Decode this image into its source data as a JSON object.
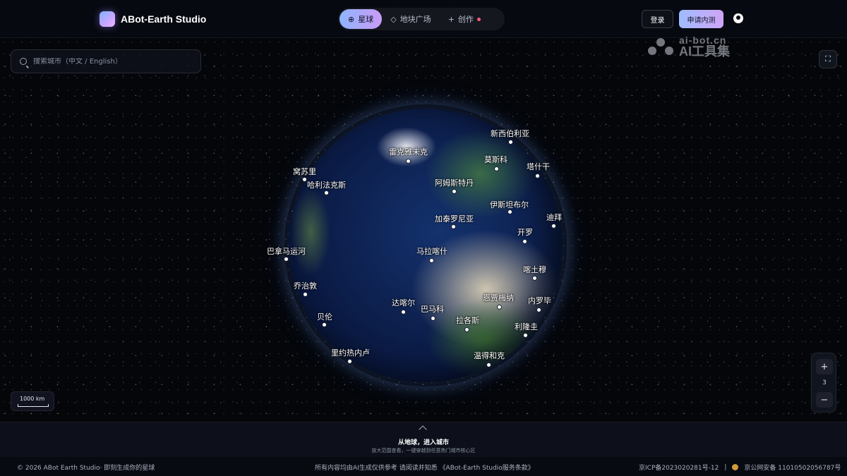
{
  "header": {
    "brand_name": "ABot-Earth Studio",
    "tabs": [
      {
        "label": "星球",
        "icon": "globe-icon",
        "active": true
      },
      {
        "label": "地块广场",
        "icon": "layers-icon",
        "active": false
      },
      {
        "label": "创作",
        "icon": "plus-icon",
        "active": false,
        "badge": true
      }
    ],
    "login_label": "登录",
    "apply_label": "申请内测",
    "github_icon": "github-icon"
  },
  "watermark": {
    "url": "ai-bot.cn",
    "name": "AI工具集"
  },
  "search": {
    "placeholder": "搜索城市（中文 / English）"
  },
  "cities": [
    {
      "name": "新西伯利亚"
    },
    {
      "name": "雷克雅未克"
    },
    {
      "name": "莫斯科"
    },
    {
      "name": "塔什干"
    },
    {
      "name": "窝苏里"
    },
    {
      "name": "哈利法克斯"
    },
    {
      "name": "阿姆斯特丹"
    },
    {
      "name": "伊斯坦布尔"
    },
    {
      "name": "加泰罗尼亚"
    },
    {
      "name": "迪拜"
    },
    {
      "name": "开罗"
    },
    {
      "name": "巴拿马运河"
    },
    {
      "name": "马拉喀什"
    },
    {
      "name": "喀土穆"
    },
    {
      "name": "乔治敦"
    },
    {
      "name": "恩贾梅纳"
    },
    {
      "name": "内罗毕"
    },
    {
      "name": "达喀尔"
    },
    {
      "name": "巴马科"
    },
    {
      "name": "贝伦"
    },
    {
      "name": "拉各斯"
    },
    {
      "name": "利隆圭"
    },
    {
      "name": "里约热内卢"
    },
    {
      "name": "温得和克"
    }
  ],
  "scale": {
    "label": "1000 km"
  },
  "zoom": {
    "in": "+",
    "level": "3",
    "out": "−"
  },
  "banner": {
    "title": "从地球，进入城市",
    "subtitle": "放大范围查看，一键穿越到任意热门城市核心区"
  },
  "footer": {
    "left": "© 2026 ABot Earth Studio· 即刻生成你的星球",
    "middle": "所有内容均由AI生成仅供参考 请阅读并知悉 《ABot-Earth Studio服务条款》",
    "icp": "京ICP备2023020281号-12",
    "separator": "|",
    "police": "京公网安备 11010502056787号"
  }
}
